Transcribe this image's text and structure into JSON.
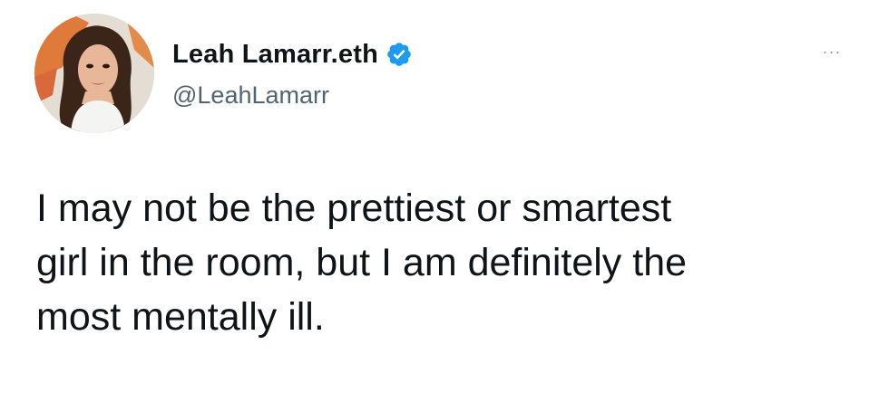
{
  "tweet": {
    "author": {
      "display_name": "Leah Lamarr.eth",
      "handle": "@LeahLamarr",
      "verified": true,
      "verified_icon": "verified-badge-icon",
      "avatar_icon": "avatar-photo"
    },
    "more_icon": "more-options-icon",
    "more_label": "···",
    "text": "I may not be the prettiest or smartest\ngirl in the room, but I am definitely the\nmost mentally ill."
  },
  "colors": {
    "text": "#0f1419",
    "secondary_text": "#536471",
    "verified": "#1d9bf0",
    "background": "#ffffff"
  }
}
